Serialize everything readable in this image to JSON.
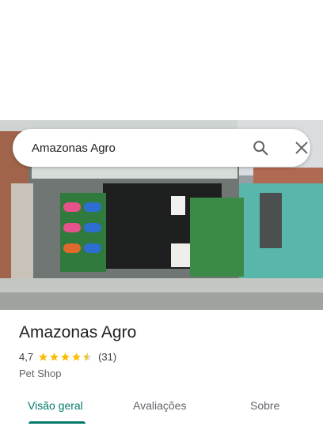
{
  "search": {
    "query": "Amazonas Agro"
  },
  "place": {
    "name": "Amazonas Agro",
    "rating": "4,7",
    "stars_filled": 4.5,
    "review_count": "(31)",
    "category": "Pet Shop"
  },
  "tabs": [
    {
      "label": "Visão geral",
      "active": true
    },
    {
      "label": "Avaliações",
      "active": false
    },
    {
      "label": "Sobre",
      "active": false
    }
  ],
  "colors": {
    "accent": "#00796b",
    "star": "#fbbc04"
  }
}
